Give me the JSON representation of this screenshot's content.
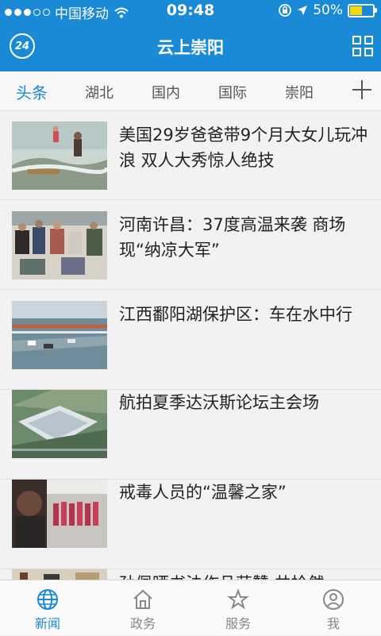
{
  "status": {
    "carrier": "中国移动",
    "time": "09:48",
    "battery": "50%",
    "battery_level": 0.5
  },
  "header": {
    "logo_text": "24",
    "title": "云上崇阳"
  },
  "tabs": [
    {
      "label": "头条",
      "active": true
    },
    {
      "label": "湖北"
    },
    {
      "label": "国内"
    },
    {
      "label": "国际"
    },
    {
      "label": "崇阳"
    }
  ],
  "news": [
    {
      "headline": "美国29岁爸爸带9个月大女儿玩冲浪 双人大秀惊人绝技"
    },
    {
      "headline": "河南许昌：37度高温来袭 商场现“纳凉大军”"
    },
    {
      "headline": "江西鄱阳湖保护区：车在水中行"
    },
    {
      "headline": "航拍夏季达沃斯论坛主会场"
    },
    {
      "headline": "戒毒人员的“温馨之家”"
    },
    {
      "headline": "孙佩晒书法作品获赞 共抢然"
    }
  ],
  "bottom_nav": [
    {
      "label": "新闻",
      "icon": "globe-icon",
      "active": true
    },
    {
      "label": "政务",
      "icon": "home-icon"
    },
    {
      "label": "服务",
      "icon": "star-icon"
    },
    {
      "label": "我",
      "icon": "user-icon"
    }
  ],
  "colors": {
    "brand": "#1a8ad6",
    "battery": "#f5d90a"
  }
}
